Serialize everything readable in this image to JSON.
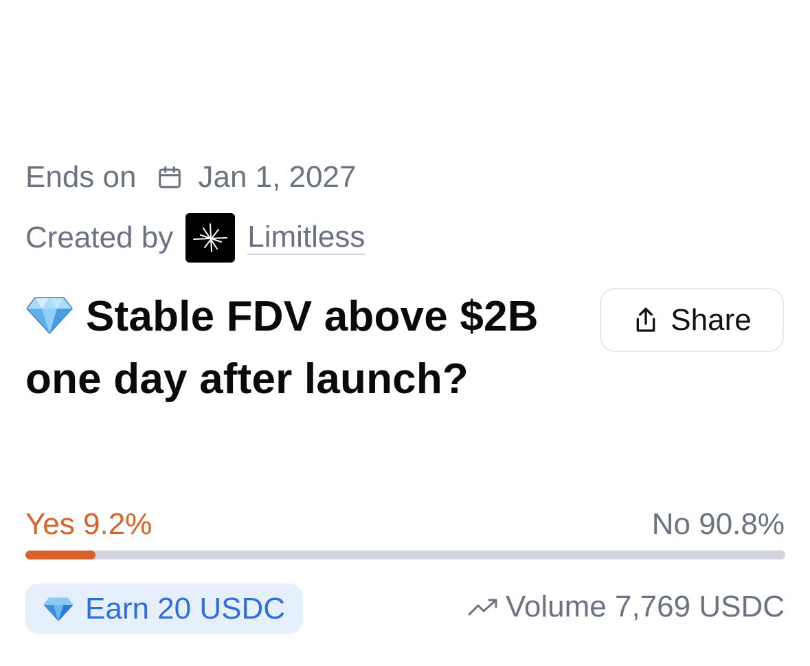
{
  "market": {
    "ends_label": "Ends on",
    "end_date": "Jan 1, 2027",
    "created_label": "Created by",
    "creator_name": "Limitless",
    "title": "Stable FDV above $2B one day after launch?",
    "share_label": "Share",
    "yes_label": "Yes 9.2%",
    "no_label": "No 90.8%",
    "yes_fraction": 0.092,
    "earn_label": "Earn 20 USDC",
    "volume_label": "Volume 7,769 USDC"
  },
  "icons": {
    "calendar": "calendar-icon",
    "creator_avatar": "limitless-logo",
    "title_emoji": "gem-icon",
    "share": "share-icon",
    "earn": "gem-icon",
    "volume": "trending-up-icon"
  },
  "colors": {
    "yes": "#d9622b",
    "no_track": "#d1d5db",
    "earn_text": "#2f6fdd",
    "earn_bg": "#e6f0fd",
    "muted_text": "#6b7280",
    "title_text": "#0a0a0a"
  }
}
